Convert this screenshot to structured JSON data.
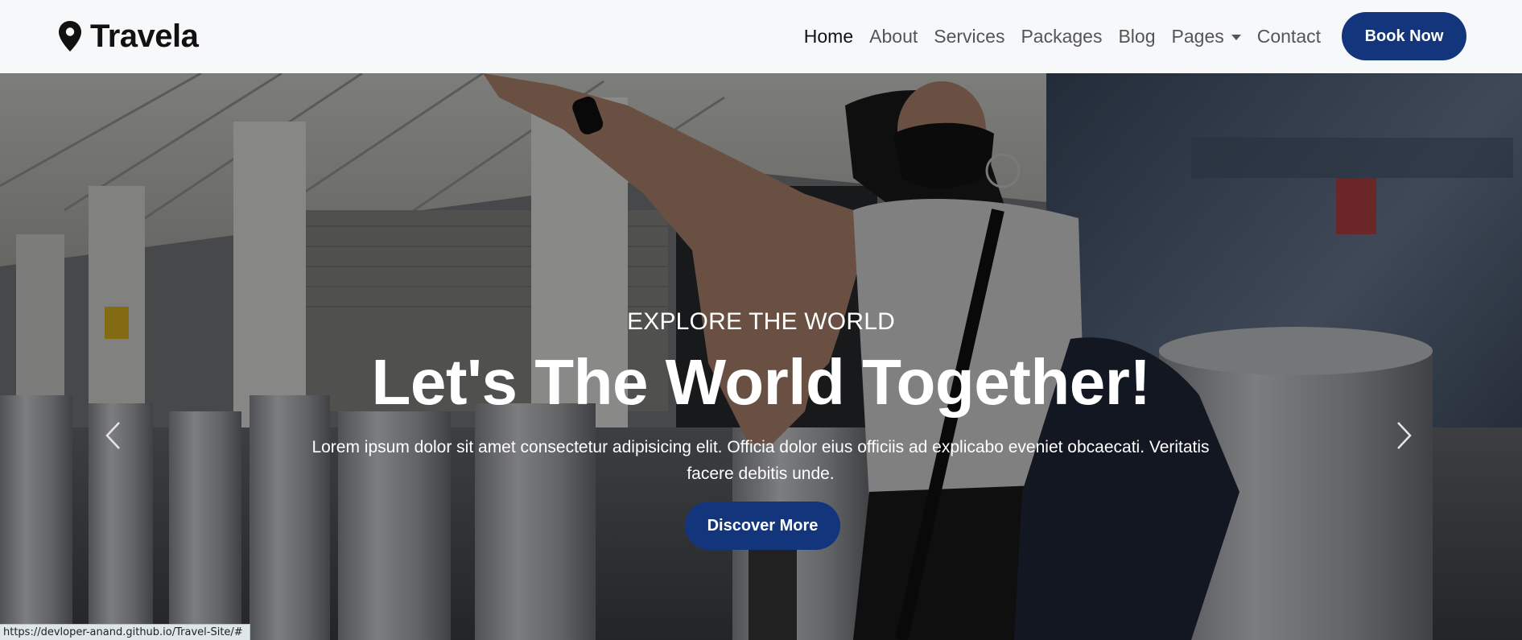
{
  "brand": {
    "name": "Travela",
    "icon": "map-marker-icon"
  },
  "nav": {
    "items": [
      {
        "label": "Home",
        "active": true
      },
      {
        "label": "About",
        "active": false
      },
      {
        "label": "Services",
        "active": false
      },
      {
        "label": "Packages",
        "active": false
      },
      {
        "label": "Blog",
        "active": false
      },
      {
        "label": "Pages",
        "active": false,
        "dropdown": true
      },
      {
        "label": "Contact",
        "active": false
      }
    ],
    "cta_label": "Book Now"
  },
  "hero": {
    "subtitle": "EXPLORE THE WORLD",
    "title": "Let's The World Together!",
    "description": "Lorem ipsum dolor sit amet consectetur adipisicing elit. Officia dolor eius officiis ad explicabo eveniet obcaecati. Veritatis facere debitis unde.",
    "button_label": "Discover More",
    "prev_icon": "chevron-left-icon",
    "next_icon": "chevron-right-icon"
  },
  "status_bar": {
    "url": "https://devloper-anand.github.io/Travel-Site/#"
  },
  "colors": {
    "primary": "#13357b",
    "nav_background": "#f7f8fa",
    "nav_text": "#555555",
    "nav_active_text": "#111111"
  }
}
